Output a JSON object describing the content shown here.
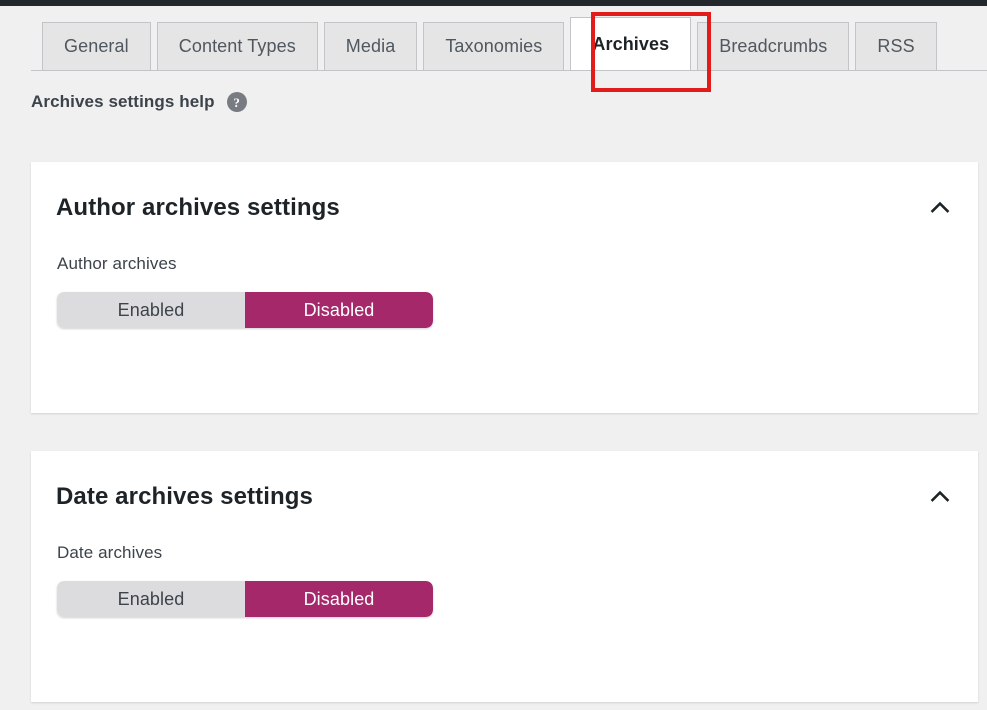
{
  "admin_bar": {
    "color": "#23282d"
  },
  "tabs": [
    {
      "label": "General",
      "active": false
    },
    {
      "label": "Content Types",
      "active": false
    },
    {
      "label": "Media",
      "active": false
    },
    {
      "label": "Taxonomies",
      "active": false
    },
    {
      "label": "Archives",
      "active": true
    },
    {
      "label": "Breadcrumbs",
      "active": false
    },
    {
      "label": "RSS",
      "active": false
    }
  ],
  "highlight": {
    "color": "#e21b1b",
    "target": "Archives"
  },
  "help": {
    "label": "Archives settings help",
    "icon": "help-circle-icon",
    "icon_glyph": "?"
  },
  "sections": [
    {
      "title": "Author archives settings",
      "collapse_icon": "chevron-up-icon",
      "field": {
        "label": "Author archives",
        "options": [
          "Enabled",
          "Disabled"
        ],
        "selected": "Disabled"
      }
    },
    {
      "title": "Date archives settings",
      "collapse_icon": "chevron-up-icon",
      "field": {
        "label": "Date archives",
        "options": [
          "Enabled",
          "Disabled"
        ],
        "selected": "Disabled"
      }
    }
  ],
  "colors": {
    "page_background": "#f0f0f1",
    "accent_selected": "#a4286a",
    "toggle_unselected": "#dcdcde",
    "highlight_box": "#e21b1b",
    "tab_inactive": "#e5e5e5",
    "tab_active": "#ffffff"
  }
}
